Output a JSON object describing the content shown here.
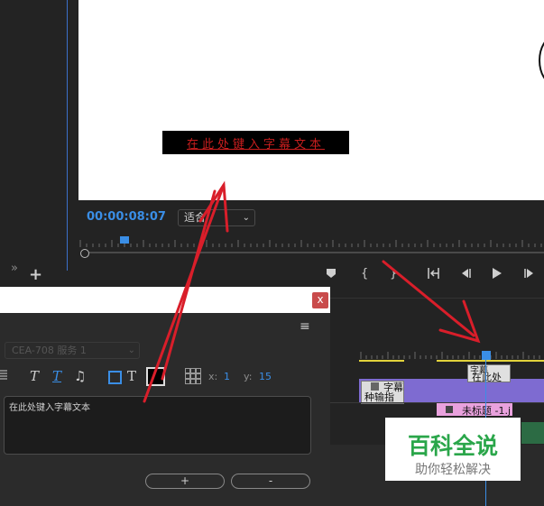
{
  "monitor": {
    "caption_overlay": "在此处键入字幕文本",
    "timecode": "00:00:08:07",
    "fit_value": "适合"
  },
  "transport": {
    "marker_icon": "marker-icon",
    "in_icon": "mark-in-icon",
    "out_icon": "mark-out-icon",
    "goto_in_icon": "go-to-in-icon",
    "step_back_icon": "step-back-icon",
    "play_icon": "play-icon",
    "step_forward_icon": "step-forward-icon"
  },
  "dialog": {
    "close_label": "x",
    "menu_label": "≡",
    "service_value": "CEA-708 服务 1",
    "toolbar": {
      "x_label": "x:",
      "x_value": "1",
      "y_label": "y:",
      "y_value": "15"
    },
    "caption_text": "在此处键入字幕文本",
    "add_label": "+",
    "remove_label": "-"
  },
  "timeline": {
    "clip_a_line1": "字幕",
    "clip_a_line2": "在此处",
    "clip_b_line1": "字幕",
    "clip_b_line2": "种输指",
    "pink_clip_label": "未标题 -1.j"
  },
  "watermark": {
    "title": "百科全说",
    "subtitle": "助你轻松解决"
  },
  "colors": {
    "accent_blue": "#3a8ee6",
    "caption_red": "#c81e1e",
    "arrow_red": "#d91e2a",
    "track_purple": "#7e6bd1",
    "clip_pink": "#e9a1dd",
    "watermark_green": "#2aa64a"
  }
}
